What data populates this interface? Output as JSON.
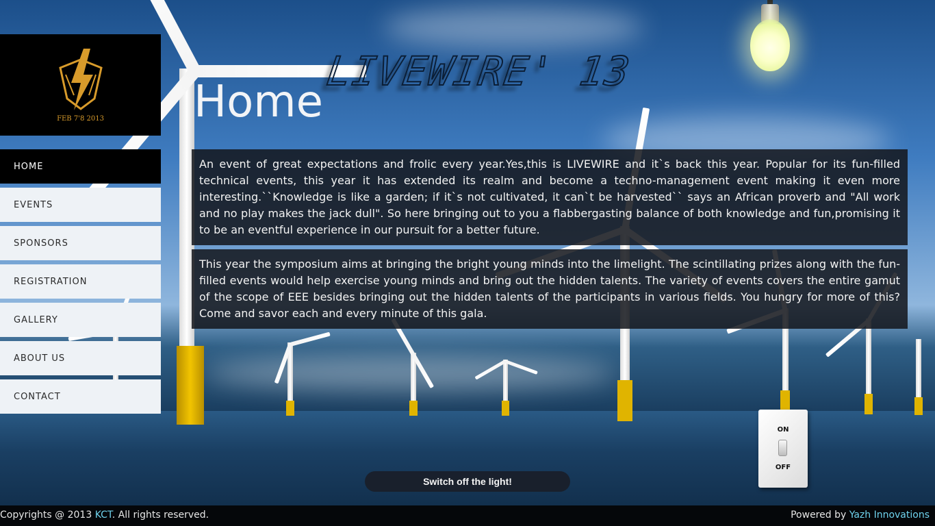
{
  "site": {
    "title": "LIVEWIRE' 13"
  },
  "logo": {
    "alt_text": "LIVEWIRE",
    "date_text": "FEB 7'8 2013"
  },
  "page": {
    "heading": "Home"
  },
  "nav": {
    "items": [
      {
        "label": "HOME",
        "active": true
      },
      {
        "label": "EVENTS",
        "active": false
      },
      {
        "label": "SPONSORS",
        "active": false
      },
      {
        "label": "REGISTRATION",
        "active": false
      },
      {
        "label": "GALLERY",
        "active": false
      },
      {
        "label": "ABOUT US",
        "active": false
      },
      {
        "label": "CONTACT",
        "active": false
      }
    ]
  },
  "content": {
    "paragraph_1": "An event of great expectations and frolic every year.Yes,this is LIVEWIRE and it`s back this year. Popular for its fun-filled technical events, this year it has extended its realm and become a techno-management event making it even more interesting.``Knowledge is like a garden; if it`s not cultivated, it can`t be harvested`` says an African proverb and \"All work and no play makes the jack dull\". So here bringing out to you a flabbergasting balance of both knowledge and fun,promising it to be an eventful experience in our pursuit for a better future.",
    "paragraph_2": "This year the symposium aims at bringing the bright young minds into the limelight. The scintillating prizes along with the fun-filled events would help exercise young minds and bring out the hidden talents. The variety of events covers the entire gamut of the scope of EEE besides bringing out the hidden talents of the participants in various fields. You hungry for more of this? Come and savor each and every minute of this gala."
  },
  "light_switch": {
    "on_label": "ON",
    "off_label": "OFF",
    "caption": "Switch off the light!"
  },
  "footer": {
    "copyright_prefix": "Copyrights @ 2013 ",
    "copyright_link": "KCT",
    "copyright_suffix": ". All rights reserved.",
    "powered_prefix": "Powered by ",
    "powered_link": "Yazh Innovations"
  },
  "colors": {
    "accent_link": "#6fd3ee",
    "logo_orange": "#d89b2b",
    "panel_bg": "#14161c",
    "nav_active_bg": "#000000",
    "nav_bg": "#eef2f6"
  }
}
